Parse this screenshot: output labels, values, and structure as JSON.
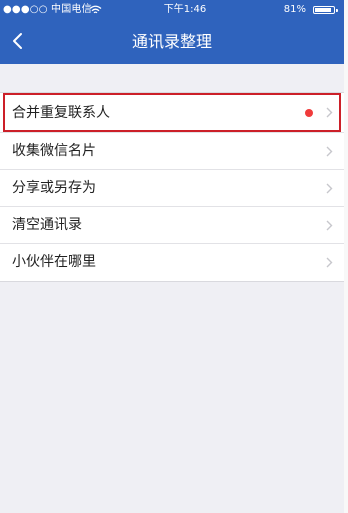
{
  "status_bar": {
    "carrier": "●●●○○ 中国电信 ",
    "wifi_icon": "wifi-icon",
    "time": "下午1:46",
    "battery": "81%",
    "battery_icon": "battery-icon"
  },
  "nav": {
    "back_icon": "chevron-left-icon",
    "title": "通讯录整理"
  },
  "menu": [
    {
      "label": "合并重复联系人",
      "badge": true
    },
    {
      "label": "收集微信名片"
    },
    {
      "label": "分享或另存为"
    },
    {
      "label": "清空通讯录"
    },
    {
      "label": "小伙伴在哪里"
    }
  ],
  "colors": {
    "nav_blue": "#2f63bd",
    "background": "#efeff4",
    "highlight_red": "#cc1f28",
    "badge_red": "#f03b3b"
  }
}
